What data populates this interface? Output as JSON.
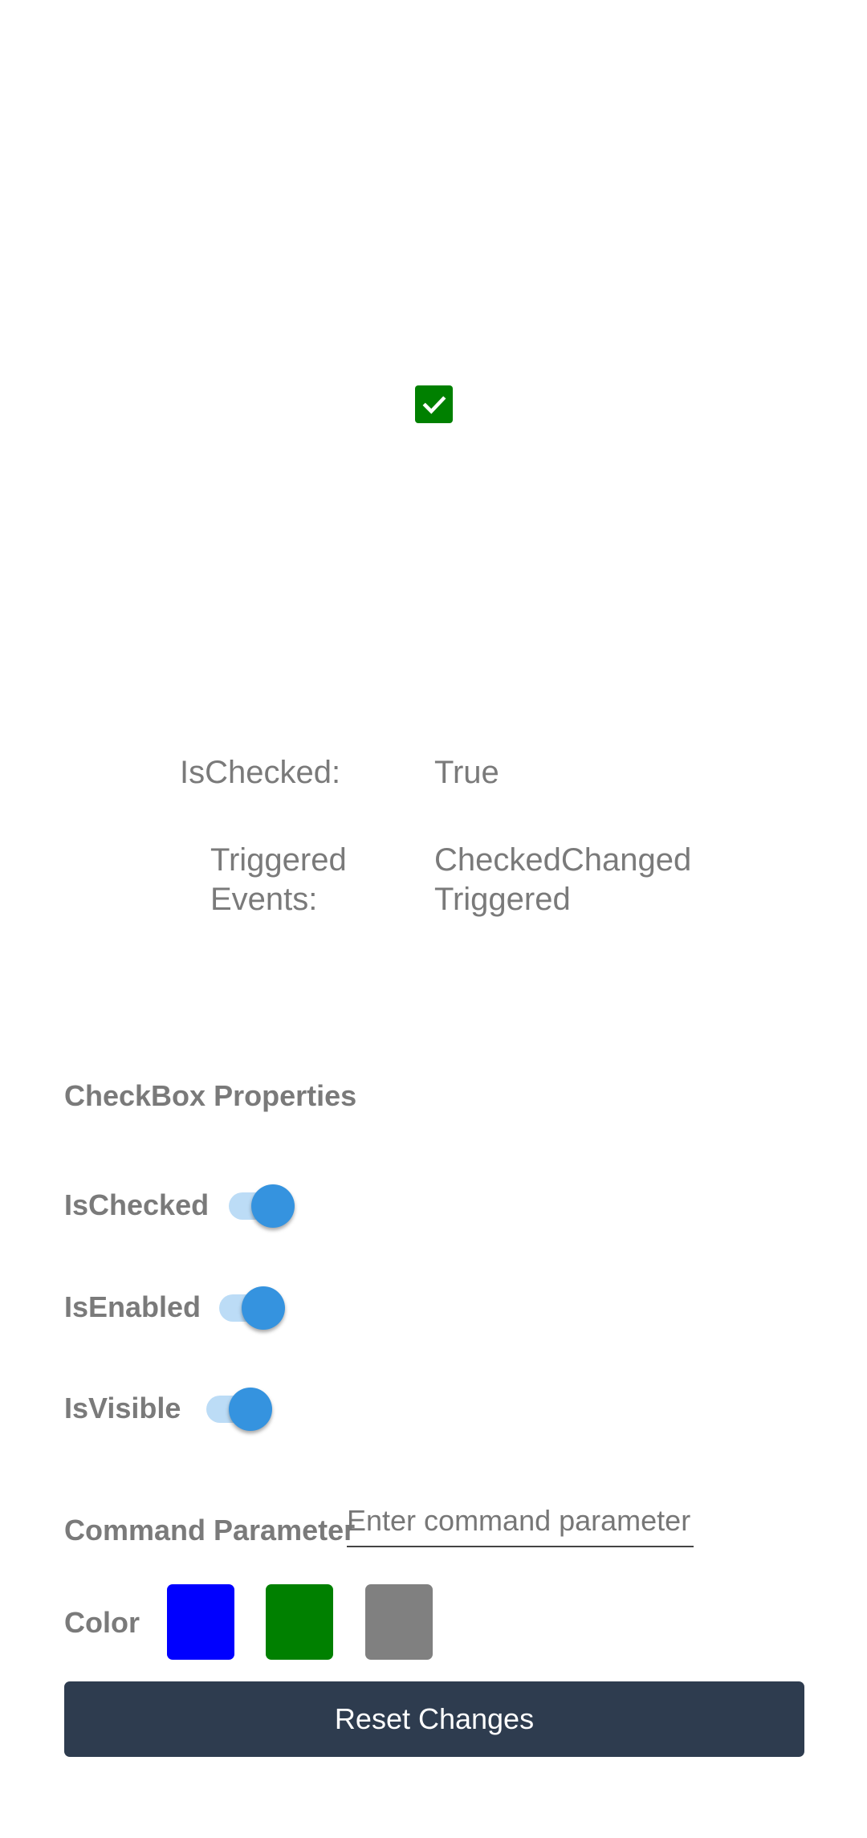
{
  "checkbox": {
    "checked": true,
    "color": "#008000"
  },
  "info": {
    "is_checked_label": "IsChecked:",
    "is_checked_value": "True",
    "events_label": "Triggered Events:",
    "events_value": "CheckedChanged Triggered"
  },
  "properties": {
    "title": "CheckBox Properties",
    "switches": [
      {
        "label": "IsChecked",
        "on": true
      },
      {
        "label": "IsEnabled",
        "on": true
      },
      {
        "label": "IsVisible",
        "on": true
      }
    ],
    "command_parameter": {
      "label": "Command Parameter",
      "placeholder": "Enter command parameter",
      "value": ""
    },
    "color": {
      "label": "Color",
      "swatches": [
        "#0000ff",
        "#008000",
        "#808080"
      ]
    }
  },
  "reset_button": {
    "label": "Reset Changes",
    "color": "#2e3c4f"
  }
}
